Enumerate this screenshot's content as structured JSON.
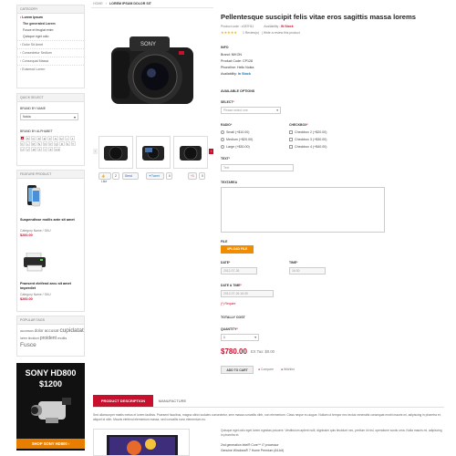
{
  "breadcrumb": {
    "home": "HOME",
    "sep": "›",
    "current": "LOREM IPSUM DOLOR SIT"
  },
  "category": {
    "heading": "CATEGORY",
    "items": [
      {
        "label": "Lorem Ipsum",
        "active": true
      },
      {
        "label": "Dolor Sit Amet"
      },
      {
        "label": "Consectetur Sedlum"
      },
      {
        "label": "Consequat Massa"
      },
      {
        "label": "Euismod Lorem"
      }
    ],
    "sub_items": [
      "The generated Lorem",
      "Fusce et feugiat enim",
      "Quisque eget odio"
    ]
  },
  "quick_select": {
    "heading": "QUICK SELECT",
    "brand_label": "BRAND BY NAME",
    "brand_value": "Nokia",
    "alphabet_label": "BRAND BY ALPHABET",
    "letters": [
      "A",
      "B",
      "C",
      "D",
      "E",
      "F",
      "G",
      "H",
      "I",
      "J",
      "K",
      "L",
      "M",
      "N",
      "O",
      "P",
      "Q",
      "R",
      "S",
      "T",
      "U",
      "V",
      "W",
      "X",
      "Y",
      "Z",
      "0-9"
    ]
  },
  "featured": {
    "heading": "FEATURE PRODUCT",
    "products": [
      {
        "name": "Suspendisse mollis ante sit amet",
        "meta": "Category Name / SKU",
        "price": "$260.00"
      },
      {
        "name": "Praesent eleifend arcu sit amet imperdiet",
        "meta": "Category Name / SKU",
        "price": "$260.00"
      }
    ]
  },
  "popular_tags": {
    "heading": "POPULAR TAGS",
    "tags": [
      "accumsan",
      "dolor",
      "accusat",
      "cupidatat",
      "lorem tincidunt",
      "proident",
      "mollis",
      "Fusce"
    ]
  },
  "banner": {
    "title": "SONY HD800",
    "price": "$1200",
    "cta": "SHOP SONY HD800"
  },
  "product": {
    "title": "Pellentesque suscipit felis vitae eros sagittis massa lorems",
    "code_line": "Product code : #287H11",
    "availability_line_label": "Availability :",
    "availability_line_value": "IN Stock",
    "reviews": "1 Review(s)",
    "write_review": "Write a review this product",
    "info_heading": "INFO",
    "brand": "Brand: NIKON",
    "code": "Product Code: CP128",
    "phone": "Phoneline: Hello Nokia",
    "availability_label": "Availability:",
    "availability_value": "In Stock"
  },
  "options": {
    "heading": "AVAILABLE OPTIONS",
    "select_label": "SELECT",
    "select_placeholder": "Please select one",
    "radio_label": "RADIO",
    "radio_items": [
      "Small (+$10.00)",
      "Medium (+$20.00)",
      "Large (+$30.00)"
    ],
    "checkbox_label": "CHECKBOX",
    "checkbox_items": [
      "Checkbox 2 (+$20.00)",
      "Checkbox 3 (+$30.00)",
      "Checkbox 4 (+$40.00)"
    ],
    "text_label": "TEXT",
    "text_value": "Text",
    "textarea_label": "TEXTAREA",
    "file_label": "FILE",
    "file_button": "UPLOAD FILE",
    "date_label": "DATE",
    "date_value": "2012-07-26",
    "time_label": "TIME",
    "time_value": "16:30",
    "datetime_label": "DATE & TIME",
    "datetime_value": "2012-07-26 16:30",
    "required_note": "(*) Require"
  },
  "totals": {
    "heading": "TOTALLY COST",
    "quantity_label": "QUANTITY",
    "quantity_value": "1",
    "price": "$780.00",
    "ex_tax": "EX Tax: $0.00",
    "add_to_cart": "ADD TO CART",
    "compare": "Compare",
    "wishlist": "Wishlist"
  },
  "share": {
    "like": "Like",
    "like_count": "2",
    "send": "Send",
    "tweet": "Tweet",
    "tweet_count": "0",
    "plus": "+1",
    "plus_count": "0"
  },
  "tabs": {
    "description": "PRODUCT DESCRIPTION",
    "manufacture": "MANUFACTURE"
  },
  "description": {
    "paragraph1": "Sed ullamcorper mattis metus et lorem facilisis. Praesent faucibus, magna ultrici sodales consectetur, sem massa convallis nibh, non elementum. Class neque eu augue. Nullam ut tempor nec lectus venenatis consequat morbi mauris mi, adipiscing in pharetra et, aliquet id nibh. Mauris eleifend elementum massa, sed convallis nunc elementum eu.",
    "paragraph2": "Quisque eget odio eget lorem egestas posuere. Vestibulum aptent nulli, dignissim quis tincidunt nec, pretium id nisl, operatione sociis urna. Nulla mauris mi, adipiscing in pharetra et.",
    "spec1": "2nd generation Intel® Core™ i7 processor",
    "spec2": "Genuine Windows® 7 Home Premium (64-bit)"
  },
  "colors": {
    "accent": "#c8102e",
    "orange": "#f08c00",
    "link": "#0076c0",
    "stock": "#2a9d3b"
  }
}
